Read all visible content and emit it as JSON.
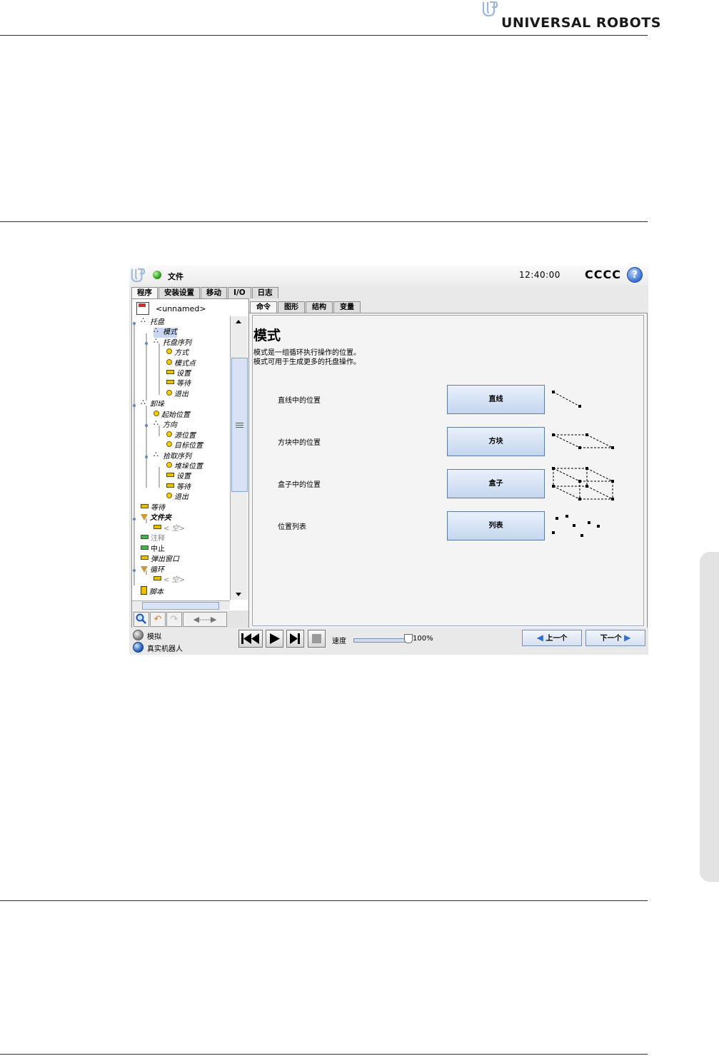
{
  "page": {
    "brand": "UNIVERSAL ROBOTS"
  },
  "window": {
    "file_label": "文件",
    "clock": "12:40:00",
    "robot_name": "CCCC",
    "help": "?",
    "main_tabs": [
      "程序",
      "安装设置",
      "移动",
      "I/O",
      "日志"
    ],
    "active_main_tab": "程序"
  },
  "tree": {
    "program_name": "<unnamed>",
    "items": [
      {
        "label": "托盘",
        "icon": "pallet-icon"
      },
      {
        "label": "模式",
        "icon": "pallet-icon",
        "selected": true
      },
      {
        "label": "托盘序列",
        "icon": "pallet-icon"
      },
      {
        "label": "方式",
        "icon": "waypoint-icon"
      },
      {
        "label": "模式点",
        "icon": "waypoint-icon"
      },
      {
        "label": "设置",
        "icon": "set-icon"
      },
      {
        "label": "等待",
        "icon": "wait-icon"
      },
      {
        "label": "退出",
        "icon": "waypoint-icon"
      },
      {
        "label": "卸垛",
        "icon": "pallet-icon"
      },
      {
        "label": "起始位置",
        "icon": "waypoint-icon"
      },
      {
        "label": "方向",
        "icon": "pallet-icon"
      },
      {
        "label": "源位置",
        "icon": "waypoint-icon"
      },
      {
        "label": "目标位置",
        "icon": "waypoint-icon"
      },
      {
        "label": "拾取序列",
        "icon": "pallet-icon"
      },
      {
        "label": "堆垛位置",
        "icon": "waypoint-icon"
      },
      {
        "label": "设置",
        "icon": "set-icon"
      },
      {
        "label": "等待",
        "icon": "wait-icon"
      },
      {
        "label": "退出",
        "icon": "waypoint-icon"
      },
      {
        "label": "等待",
        "icon": "wait-icon"
      },
      {
        "label": "文件夹",
        "icon": "folder-icon"
      },
      {
        "label": "< 空>",
        "icon": "empty-icon"
      },
      {
        "label": "注释",
        "icon": "comment-icon"
      },
      {
        "label": "中止",
        "icon": "halt-icon"
      },
      {
        "label": "弹出窗口",
        "icon": "popup-icon"
      },
      {
        "label": "循环",
        "icon": "loop-icon"
      },
      {
        "label": "< 空>",
        "icon": "empty-icon"
      },
      {
        "label": "脚本",
        "icon": "script-icon"
      }
    ]
  },
  "sub_tabs": [
    "命令",
    "图形",
    "结构",
    "变量"
  ],
  "active_sub_tab": "命令",
  "command": {
    "title": "模式",
    "description_line1": "模式是一组循环执行操作的位置。",
    "description_line2": "模式可用于生成更多的托盘操作。",
    "rows": [
      {
        "label": "直线中的位置",
        "button": "直线"
      },
      {
        "label": "方块中的位置",
        "button": "方块"
      },
      {
        "label": "盒子中的位置",
        "button": "盒子"
      },
      {
        "label": "位置列表",
        "button": "列表"
      }
    ]
  },
  "bottom": {
    "sim_label": "模拟",
    "real_label": "真实机器人",
    "speed_label": "速度",
    "speed_value": "100%",
    "speed_fraction": 1.0,
    "prev_label": "上一个",
    "next_label": "下一个"
  },
  "colors": {
    "accent_blue": "#2f6fd0",
    "button_top": "#e9f1fb",
    "button_bottom": "#c4d6ee",
    "status_green": "#2e9e1f"
  }
}
